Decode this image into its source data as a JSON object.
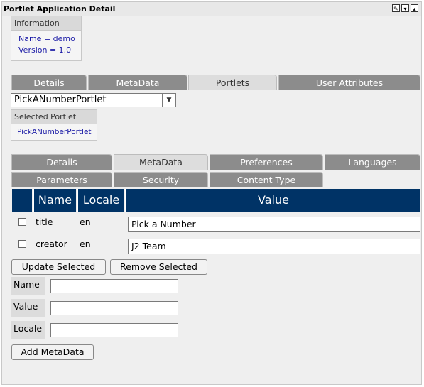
{
  "window": {
    "title": "Portlet Application Detail",
    "buttons": [
      "edit-icon",
      "minimize-icon",
      "maximize-icon"
    ]
  },
  "info": {
    "header": "Information",
    "name_line": "Name = demo",
    "version_line": "Version = 1.0"
  },
  "top_tabs": [
    {
      "label": "Details",
      "active": false
    },
    {
      "label": "MetaData",
      "active": false
    },
    {
      "label": "Portlets",
      "active": true
    },
    {
      "label": "User Attributes",
      "active": false
    }
  ],
  "portlet_select": {
    "value": "PickANumberPortlet"
  },
  "selected_portlet": {
    "header": "Selected Portlet",
    "value": "PickANumberPortlet"
  },
  "sub_tabs_row1": [
    {
      "label": "Details",
      "active": false
    },
    {
      "label": "MetaData",
      "active": true
    },
    {
      "label": "Preferences",
      "active": false
    },
    {
      "label": "Languages",
      "active": false
    }
  ],
  "sub_tabs_row2": [
    {
      "label": "Parameters",
      "active": false
    },
    {
      "label": "Security",
      "active": false
    },
    {
      "label": "Content Type",
      "active": false
    }
  ],
  "table": {
    "headers": [
      "Name",
      "Locale",
      "Value"
    ],
    "rows": [
      {
        "name": "title",
        "locale": "en",
        "value": "Pick a Number"
      },
      {
        "name": "creator",
        "locale": "en",
        "value": "J2 Team"
      }
    ]
  },
  "actions": {
    "update": "Update Selected",
    "remove": "Remove Selected",
    "add": "Add MetaData"
  },
  "form": {
    "name_label": "Name",
    "value_label": "Value",
    "locale_label": "Locale",
    "name_value": "",
    "value_value": "",
    "locale_value": ""
  },
  "colors": {
    "table_header": "#003366",
    "tab_inactive": "#8c8c8c",
    "tab_active": "#dddddd",
    "link": "#1a1aa6"
  }
}
